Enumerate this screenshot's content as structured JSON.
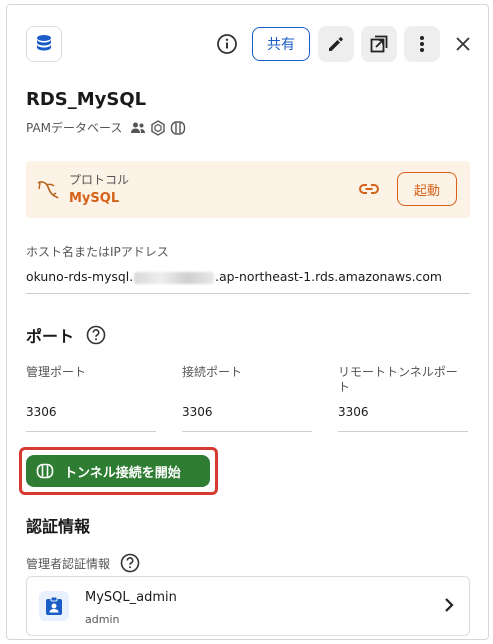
{
  "header": {
    "share_label": "共有"
  },
  "resource": {
    "title": "RDS_MySQL",
    "subtitle": "PAMデータベース"
  },
  "protocol": {
    "label": "プロトコル",
    "value": "MySQL",
    "launch_label": "起動"
  },
  "host": {
    "label": "ホスト名またはIPアドレス",
    "value_prefix": "okuno-rds-mysql.",
    "value_suffix": ".ap-northeast-1.rds.amazonaws.com"
  },
  "ports": {
    "heading": "ポート",
    "columns": [
      {
        "label": "管理ポート",
        "value": "3306"
      },
      {
        "label": "接続ポート",
        "value": "3306"
      },
      {
        "label": "リモートトンネルポート",
        "value": "3306"
      }
    ],
    "tunnel_button": "トンネル接続を開始"
  },
  "credentials": {
    "heading": "認証情報",
    "admin_label": "管理者認証情報",
    "item_name": "MySQL_admin",
    "item_sub": "admin"
  },
  "colors": {
    "accent_blue": "#1a5dc7",
    "protocol_orange": "#d4621a",
    "tunnel_green": "#2f7d32",
    "highlight_red": "#d63a31"
  }
}
